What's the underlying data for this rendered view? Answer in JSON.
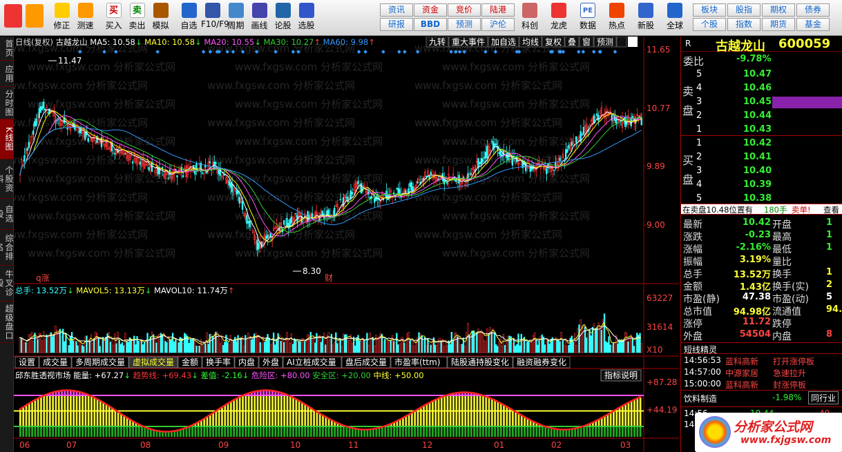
{
  "toolbar": {
    "groups": [
      {
        "label": "",
        "icon": "grid-icon"
      },
      {
        "label": "",
        "icon": "back-arrow-icon"
      },
      {
        "label": "修正",
        "icon": "up-down-icon"
      },
      {
        "label": "测速",
        "icon": "clock-icon"
      },
      {
        "label": "买入",
        "icon": "buy-icon",
        "glyph": "买"
      },
      {
        "label": "卖出",
        "icon": "sell-icon",
        "glyph": "卖"
      },
      {
        "label": "模拟",
        "icon": "hammer-icon"
      },
      {
        "label": "自选",
        "icon": "star-icon"
      },
      {
        "label": "F10/F9",
        "icon": "f10-icon"
      },
      {
        "label": "周期",
        "icon": "cycle-icon"
      },
      {
        "label": "画线",
        "icon": "pen-icon"
      },
      {
        "label": "论股",
        "icon": "discuss-icon"
      },
      {
        "label": "选股",
        "icon": "magnifier-icon"
      }
    ],
    "buttons_top": [
      "资讯",
      "资金",
      "竞价",
      "陆港"
    ],
    "buttons_bottom": [
      "研报",
      "BBD",
      "预测",
      "沪伦"
    ],
    "groups2": [
      {
        "label": "科创",
        "icon": "chart-icon"
      },
      {
        "label": "龙虎",
        "icon": "dragon-icon"
      },
      {
        "label": "数据",
        "icon": "pe-icon",
        "glyph": "PE"
      },
      {
        "label": "热点",
        "icon": "hot-icon"
      },
      {
        "label": "新股",
        "icon": "newstock-icon"
      },
      {
        "label": "全球",
        "icon": "globe-icon"
      }
    ],
    "buttons2_top": [
      "板块",
      "股指",
      "期权",
      "债券"
    ],
    "buttons2_bottom": [
      "个股",
      "指数",
      "期货",
      "基金"
    ]
  },
  "left_tabs": [
    "首页",
    "应用",
    "分时图",
    "K线图",
    "个股资料",
    "自选股",
    "综合排名",
    "牛叉诊股",
    "超级盘口"
  ],
  "chart": {
    "header": {
      "period": "日线(复权)",
      "name": "古越龙山",
      "ma5": "MA5: 10.58",
      "ma10": "MA10: 10.58",
      "ma20": "MA20: 10.55",
      "ma30": "MA30: 10.27",
      "ma60": "MA60: 9.98",
      "ma5_arrow": "↓",
      "ma10_arrow": "↓",
      "ma20_arrow": "↓",
      "ma30_arrow": "↑",
      "ma60_arrow": "↑"
    },
    "right_tools": [
      "九转",
      "重大事件",
      "加自选",
      "均线",
      "复权",
      "叠",
      "窗",
      "预测"
    ],
    "y_labels": [
      "11.65",
      "10.77",
      "9.89",
      "9.00"
    ],
    "high_label": "11.47",
    "low_label": "8.30",
    "q_label": "q涨",
    "cai_label": "财",
    "vol_header": {
      "total": "总手: 13.52万",
      "vol5": "MAVOL5: 13.13万",
      "vol10": "MAVOL10: 11.74万",
      "total_arrow": "↓",
      "vol5_arrow": "↓",
      "vol10_arrow": "↑"
    },
    "vol_y": [
      "63227",
      "31614",
      "X10"
    ],
    "tabs": [
      "设置",
      "成交量",
      "多周期成交量",
      "虚拟成交量",
      "金额",
      "换手率",
      "内盘",
      "外盘",
      "AI立桩成交量",
      "盘后成交量",
      "市盈率(ttm)",
      "陆股通持股变化",
      "融资融券变化"
    ],
    "active_tab": "虚拟成交量",
    "ind_header": {
      "name": "邱东胜透视市场",
      "energy": "能量: +67.27",
      "trend": "趋势线: +69.43",
      "diff": "差值: -2.16",
      "danger": "危险区: +80.00",
      "safe": "安全区: +20.00",
      "mid": "中线: +50.00",
      "energy_arrow": "↓",
      "trend_arrow": "↓",
      "diff_arrow": "↓",
      "explain": "指标说明"
    },
    "ind_y": [
      "+87.28",
      "+44.19"
    ],
    "x_labels": [
      "06",
      "07",
      "08",
      "09",
      "10",
      "11",
      "12",
      "01",
      "02",
      "03"
    ],
    "watermark": "www.fxgsw.com   分析家公式网",
    "colors": {
      "up": "#ff3333",
      "down": "#33ffff",
      "ma5": "#ffffff",
      "ma10": "#ffff00",
      "ma20": "#ff55ff",
      "ma30": "#33cc33",
      "ma60": "#3399ff"
    }
  },
  "right_panel": {
    "title": "古越龙山",
    "code": "600059",
    "wb_label": "委比",
    "wb_value": "-9.78%",
    "sell_label": "卖\n盘",
    "buy_label": "买\n盘",
    "sells": [
      {
        "n": "5",
        "p": "10.47"
      },
      {
        "n": "4",
        "p": "10.46"
      },
      {
        "n": "3",
        "p": "10.45"
      },
      {
        "n": "2",
        "p": "10.44"
      },
      {
        "n": "1",
        "p": "10.43"
      }
    ],
    "buys": [
      {
        "n": "1",
        "p": "10.42"
      },
      {
        "n": "2",
        "p": "10.41"
      },
      {
        "n": "3",
        "p": "10.40"
      },
      {
        "n": "4",
        "p": "10.39"
      },
      {
        "n": "5",
        "p": "10.38"
      }
    ],
    "status": "在卖盘10.48位置有",
    "status_qty": "180手",
    "status_tag": "卖单!",
    "status_view": "查看",
    "quotes": [
      {
        "l": "最新",
        "v": "10.42",
        "c": "grn",
        "l2": "开盘",
        "v2": "1"
      },
      {
        "l": "涨跌",
        "v": "-0.23",
        "c": "grn",
        "l2": "最高",
        "v2": "1"
      },
      {
        "l": "涨幅",
        "v": "-2.16%",
        "c": "grn",
        "l2": "最低",
        "v2": "1"
      },
      {
        "l": "振幅",
        "v": "3.19%",
        "c": "yel",
        "l2": "量比",
        "v2": ""
      },
      {
        "l": "总手",
        "v": "13.52万",
        "c": "yel",
        "l2": "换手",
        "v2": "1"
      },
      {
        "l": "金额",
        "v": "1.43亿",
        "c": "yel",
        "l2": "换手(实)",
        "v2": "2"
      },
      {
        "l": "市盈(静)",
        "v": "47.38",
        "c": "wht",
        "l2": "市盈(动)",
        "v2": "5"
      },
      {
        "l": "总市值",
        "v": "94.98亿",
        "c": "yel",
        "l2": "流通值",
        "v2": "94."
      },
      {
        "l": "涨停",
        "v": "11.72",
        "c": "red",
        "l2": "跌停",
        "v2": ""
      },
      {
        "l": "外盘",
        "v": "54504",
        "c": "red",
        "l2": "内盘",
        "v2": "8"
      }
    ],
    "spirit": "短线精灵",
    "events": [
      {
        "t": "14:56:53",
        "n": "蓝科高新",
        "e": "打开涨停板"
      },
      {
        "t": "14:57:00",
        "n": "中源家居",
        "e": "急速拉升"
      },
      {
        "t": "15:00:00",
        "n": "蓝科高新",
        "e": "封涨停板"
      }
    ],
    "sector": "饮料制造",
    "sector_chg": "-1.98%",
    "sector_btn": "同行业",
    "tick": {
      "t": "14:56",
      "p": "10.44",
      "q": "40"
    },
    "tick2": "14:5",
    "logo": "分析家公式网",
    "logo_url": "www.fxjgsw.com"
  }
}
